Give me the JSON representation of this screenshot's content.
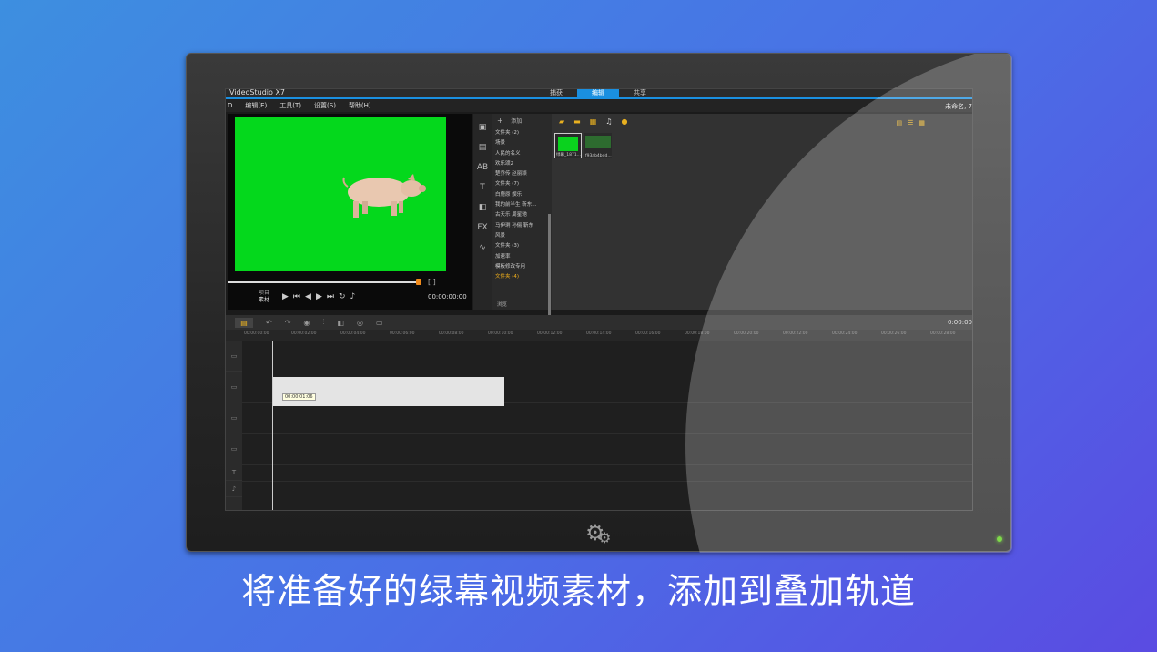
{
  "app": {
    "title": "VideoStudio X7",
    "tabs": [
      "捕获",
      "编辑",
      "共享"
    ],
    "active_tab": 1,
    "title_right": "未命名, 7"
  },
  "menu": [
    "编辑(E)",
    "工具(T)",
    "设置(S)",
    "帮助(H)"
  ],
  "menu_left": "D",
  "player": {
    "label_project": "项目",
    "label_clip": "素材",
    "timecode": "00:00:00:00",
    "brackets": "[ ]"
  },
  "library": {
    "toolbar_add": "+",
    "toolbar_label": "添加",
    "folders": [
      "文件夹 (2)",
      "场景",
      "人民的名义",
      "欢乐颂2",
      "楚乔传 赵丽颖",
      "文件夹 (7)",
      "白鹿原 娱乐",
      "我的前半生 靳东...",
      "古天乐 周星驰",
      "马伊琍 孙俪 靳东",
      "风景",
      "文件夹 (3)",
      "加速率",
      "模板修改专用",
      "文件夹 (4)"
    ],
    "selected_folder": 14,
    "browse_label": "浏览",
    "thumbs": [
      {
        "label": "绿幕_1871..."
      },
      {
        "label": "f93ab4bdd..."
      }
    ]
  },
  "timeline": {
    "right_time": "0:00:00",
    "ruler": [
      "00:00:00:00",
      "00:00:02:00",
      "00:00:04:00",
      "00:00:06:00",
      "00:00:08:00",
      "00:00:10:00",
      "00:00:12:00",
      "00:00:14:00",
      "00:00:16:00",
      "00:00:18:00",
      "00:00:20:00",
      "00:00:22:00",
      "00:00:24:00",
      "00:00:26:00",
      "00:00:28:00"
    ],
    "clip_tooltip": "00:00:01:06"
  },
  "caption": "将准备好的绿幕视频素材，添加到叠加轨道"
}
